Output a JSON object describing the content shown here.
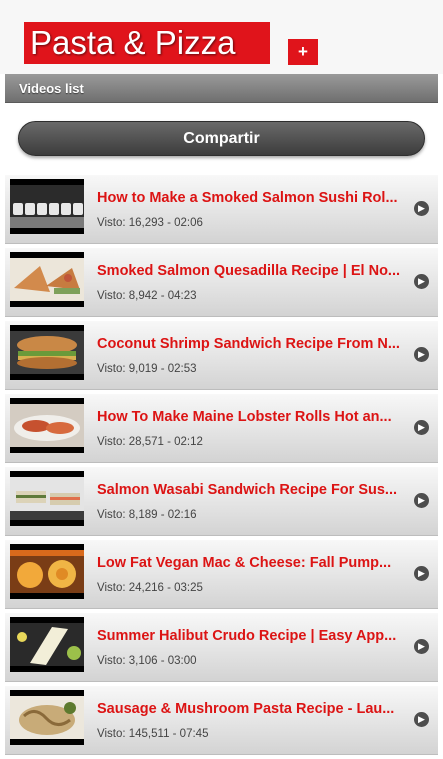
{
  "header": {
    "logo_text": "Pasta & Pizza",
    "add_label": "+"
  },
  "section": {
    "title": "Videos list"
  },
  "share_label": "Compartir",
  "videos": [
    {
      "title": "How to Make a Smoked Salmon Sushi Rol...",
      "views": "Visto: 16,293",
      "duration": "02:06",
      "meta": "Visto: 16,293 - 02:06",
      "thumb": [
        "#1a1a1a",
        "#6b6b6b",
        "#d9d9d9"
      ]
    },
    {
      "title": "Smoked Salmon Quesadilla Recipe | El No...",
      "views": "Visto: 8,942",
      "duration": "04:23",
      "meta": "Visto: 8,942 - 04:23",
      "thumb": [
        "#e9e2d6",
        "#c47a45",
        "#7ea05a"
      ]
    },
    {
      "title": "Coconut Shrimp Sandwich Recipe From N...",
      "views": "Visto: 9,019",
      "duration": "02:53",
      "meta": "Visto: 9,019 - 02:53",
      "thumb": [
        "#b8743a",
        "#6a8f3a",
        "#8a4a24"
      ]
    },
    {
      "title": "How To Make Maine Lobster Rolls Hot an...",
      "views": "Visto: 28,571",
      "duration": "02:12",
      "meta": "Visto: 28,571 - 02:12",
      "thumb": [
        "#d8cfc4",
        "#c24a2e",
        "#e6e2dd"
      ]
    },
    {
      "title": "Salmon Wasabi Sandwich Recipe For Sus...",
      "views": "Visto: 8,189",
      "duration": "02:16",
      "meta": "Visto: 8,189 - 02:16",
      "thumb": [
        "#e5e5e5",
        "#5f7a3a",
        "#3b3b3b"
      ]
    },
    {
      "title": "Low Fat Vegan Mac & Cheese: Fall Pump...",
      "views": "Visto: 24,216",
      "duration": "03:25",
      "meta": "Visto: 24,216 - 03:25",
      "thumb": [
        "#d96a1c",
        "#f2a93a",
        "#7a3d16"
      ]
    },
    {
      "title": "Summer Halibut Crudo Recipe | Easy App...",
      "views": "Visto: 3,106",
      "duration": "03:00",
      "meta": "Visto: 3,106 - 03:00",
      "thumb": [
        "#2a2a2a",
        "#e8e4c8",
        "#9cc04a"
      ]
    },
    {
      "title": "Sausage & Mushroom Pasta Recipe - Lau...",
      "views": "Visto: 145,511",
      "duration": "07:45",
      "meta": "Visto: 145,511 - 07:45",
      "thumb": [
        "#ece7dc",
        "#b59a6a",
        "#5d7a2e"
      ]
    }
  ]
}
